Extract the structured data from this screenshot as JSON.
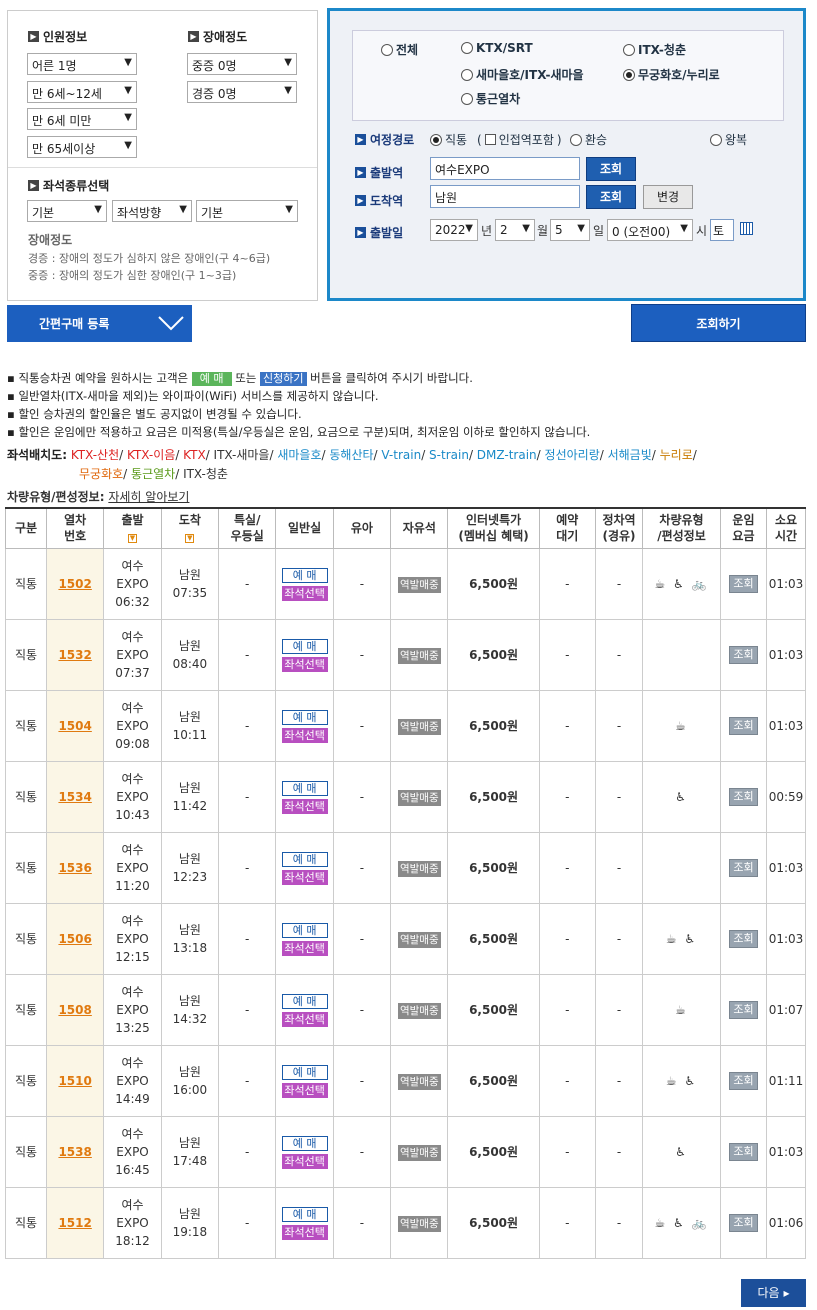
{
  "passengers": {
    "title": "인원정보",
    "adult": "어른 1명",
    "child": "만 6세~12세",
    "infant": "만 6세 미만",
    "senior": "만 65세이상"
  },
  "disability": {
    "title": "장애정도",
    "severe": "중증 0명",
    "mild": "경증 0명"
  },
  "seat_type": {
    "title": "좌석종류선택",
    "opt1": "기본",
    "opt2": "좌석방향",
    "opt3": "기본",
    "note_title": "장애정도",
    "note_mild": "경증 : 장애의 정도가 심하지 않은 장애인(구 4~6급)",
    "note_severe": "중증 : 장애의 정도가 심한 장애인(구 1~3급)"
  },
  "train_types": {
    "all": "전체",
    "ktx": "KTX/SRT",
    "itx_cheongchun": "ITX-청춘",
    "saemaeul": "새마을호/ITX-새마을",
    "mugunghwa": "무궁화호/누리로",
    "commuter": "통근열차"
  },
  "route": {
    "label": "여정경로",
    "direct": "직통",
    "nearby": "인접역포함",
    "transfer": "환승",
    "roundtrip": "왕복"
  },
  "departure": {
    "label": "출발역",
    "value": "여수EXPO",
    "btn": "조회"
  },
  "arrival": {
    "label": "도착역",
    "value": "남원",
    "btn": "조회",
    "swap": "변경"
  },
  "date": {
    "label": "출발일",
    "year": "2022",
    "year_unit": "년",
    "month": "2",
    "month_unit": "월",
    "day": "5",
    "day_unit": "일",
    "hour": "0 (오전00)",
    "hour_unit": "시",
    "weekday": "토"
  },
  "actions": {
    "simple_reg": "간편구매 등록",
    "search": "조회하기",
    "next": "다음"
  },
  "notices": {
    "n1a": "직통승차권 예약을 원하시는 고객은",
    "n1_tag1": "예 매",
    "n1b": "또는",
    "n1_tag2": "신청하기",
    "n1c": "버튼을 클릭하여 주시기 바랍니다.",
    "n2": "일반열차(ITX-새마을 제외)는 와이파이(WiFi) 서비스를 제공하지 않습니다.",
    "n3": "할인 승차권의 할인율은 별도 공지없이 변경될 수 있습니다.",
    "n4": "할인은 운임에만 적용하고 요금은 미적용(특실/우등실은 운임, 요금으로 구분)되며, 최저운임 이하로 할인하지 않습니다."
  },
  "seatmap": {
    "label": "좌석배치도:",
    "items": [
      "KTX-산천",
      "KTX-이음",
      "KTX",
      "ITX-새마을",
      "새마을호",
      "동해산타",
      "V-train",
      "S-train",
      "DMZ-train",
      "정선아리랑",
      "서해금빛",
      "누리로",
      "무궁화호",
      "통근열차",
      "ITX-청춘"
    ]
  },
  "vehicle": {
    "label": "차량유형/편성정보:",
    "link": "자세히 알아보기"
  },
  "table": {
    "headers": {
      "type": "구분",
      "no1": "열차",
      "no2": "번호",
      "dep": "출발",
      "arr": "도착",
      "first1": "특실/",
      "first2": "우등실",
      "general": "일반실",
      "infant": "유아",
      "free": "자유석",
      "special1": "인터넷특가",
      "special2": "(멤버십 혜택)",
      "wait1": "예약",
      "wait2": "대기",
      "stop1": "정차역",
      "stop2": "(경유)",
      "vtype1": "차량유형",
      "vtype2": "/편성정보",
      "fare1": "운임",
      "fare2": "요금",
      "dur1": "소요",
      "dur2": "시간"
    },
    "labels": {
      "book": "예 매",
      "seat": "좌석선택",
      "station_sale": "역발매중",
      "inquiry": "조회",
      "dash": "-"
    },
    "rows": [
      {
        "type": "직통",
        "no": "1502",
        "dep1": "여수",
        "dep2": "EXPO",
        "dep_time": "06:32",
        "arr": "남원",
        "arr_time": "07:35",
        "price": "6,500원",
        "icons": "☕ ♿ 🚲",
        "duration": "01:03"
      },
      {
        "type": "직통",
        "no": "1532",
        "dep1": "여수",
        "dep2": "EXPO",
        "dep_time": "07:37",
        "arr": "남원",
        "arr_time": "08:40",
        "price": "6,500원",
        "icons": "",
        "duration": "01:03"
      },
      {
        "type": "직통",
        "no": "1504",
        "dep1": "여수",
        "dep2": "EXPO",
        "dep_time": "09:08",
        "arr": "남원",
        "arr_time": "10:11",
        "price": "6,500원",
        "icons": "☕",
        "duration": "01:03"
      },
      {
        "type": "직통",
        "no": "1534",
        "dep1": "여수",
        "dep2": "EXPO",
        "dep_time": "10:43",
        "arr": "남원",
        "arr_time": "11:42",
        "price": "6,500원",
        "icons": "♿",
        "duration": "00:59"
      },
      {
        "type": "직통",
        "no": "1536",
        "dep1": "여수",
        "dep2": "EXPO",
        "dep_time": "11:20",
        "arr": "남원",
        "arr_time": "12:23",
        "price": "6,500원",
        "icons": "",
        "duration": "01:03"
      },
      {
        "type": "직통",
        "no": "1506",
        "dep1": "여수",
        "dep2": "EXPO",
        "dep_time": "12:15",
        "arr": "남원",
        "arr_time": "13:18",
        "price": "6,500원",
        "icons": "☕ ♿",
        "duration": "01:03"
      },
      {
        "type": "직통",
        "no": "1508",
        "dep1": "여수",
        "dep2": "EXPO",
        "dep_time": "13:25",
        "arr": "남원",
        "arr_time": "14:32",
        "price": "6,500원",
        "icons": "☕",
        "duration": "01:07"
      },
      {
        "type": "직통",
        "no": "1510",
        "dep1": "여수",
        "dep2": "EXPO",
        "dep_time": "14:49",
        "arr": "남원",
        "arr_time": "16:00",
        "price": "6,500원",
        "icons": "☕ ♿",
        "duration": "01:11"
      },
      {
        "type": "직통",
        "no": "1538",
        "dep1": "여수",
        "dep2": "EXPO",
        "dep_time": "16:45",
        "arr": "남원",
        "arr_time": "17:48",
        "price": "6,500원",
        "icons": "♿",
        "duration": "01:03"
      },
      {
        "type": "직통",
        "no": "1512",
        "dep1": "여수",
        "dep2": "EXPO",
        "dep_time": "18:12",
        "arr": "남원",
        "arr_time": "19:18",
        "price": "6,500원",
        "icons": "☕ ♿ 🚲",
        "duration": "01:06"
      }
    ]
  }
}
